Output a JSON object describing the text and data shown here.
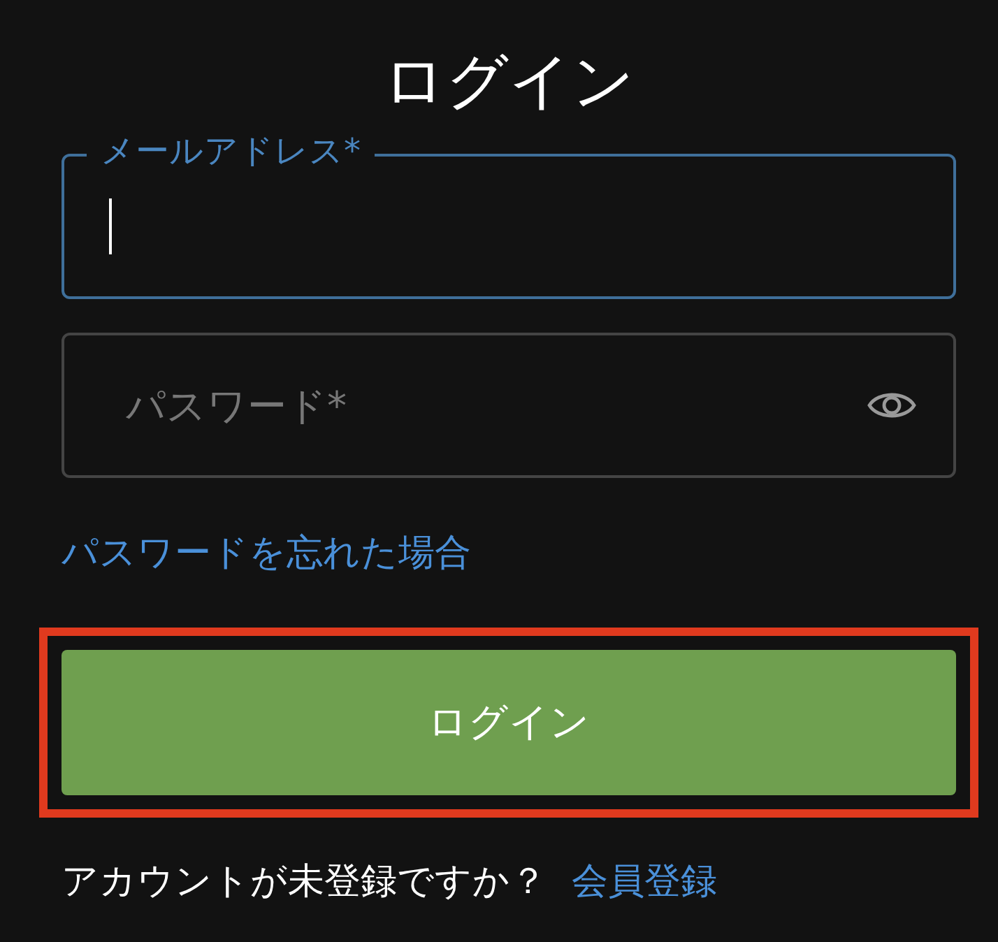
{
  "title": "ログイン",
  "email": {
    "label": "メールアドレス*",
    "focused": true
  },
  "password": {
    "placeholder": "パスワード*",
    "focused": false
  },
  "forgot_link": "パスワードを忘れた場合",
  "login_button": {
    "label": "ログイン",
    "highlighted": true
  },
  "signup": {
    "prompt": "アカウントが未登録ですか？",
    "link": "会員登録"
  }
}
